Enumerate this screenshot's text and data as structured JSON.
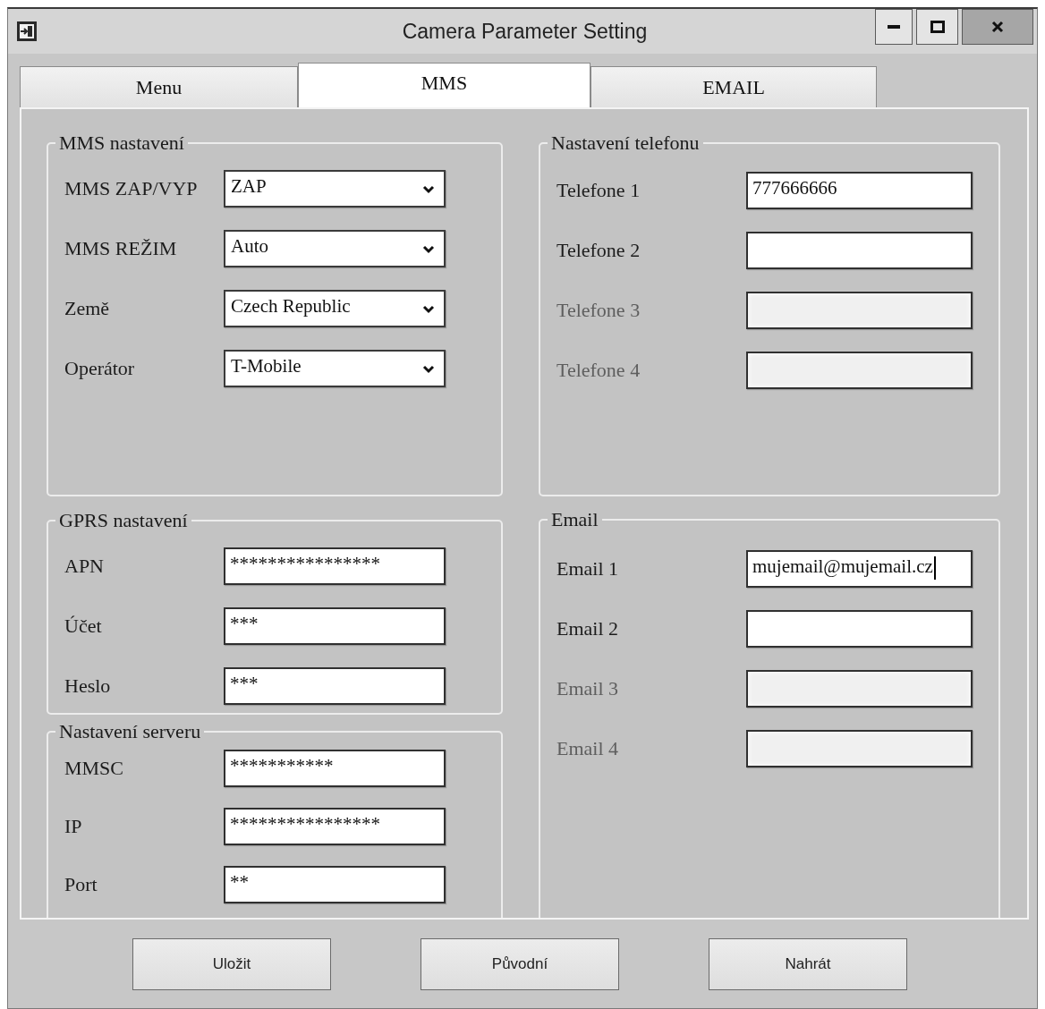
{
  "window": {
    "title": "Camera Parameter Setting"
  },
  "tabs": [
    {
      "label": "Menu",
      "selected": false
    },
    {
      "label": "MMS",
      "selected": true
    },
    {
      "label": "EMAIL",
      "selected": false
    }
  ],
  "mms_settings": {
    "title": "MMS nastavení",
    "rows": [
      {
        "label": "MMS ZAP/VYP",
        "value": "ZAP"
      },
      {
        "label": "MMS REŽIM",
        "value": "Auto"
      },
      {
        "label": "Země",
        "value": "Czech Republic"
      },
      {
        "label": "Operátor",
        "value": "T-Mobile"
      }
    ]
  },
  "gprs_settings": {
    "title": "GPRS nastavení",
    "rows": [
      {
        "label": "APN",
        "value": "****************"
      },
      {
        "label": "Účet",
        "value": "***"
      },
      {
        "label": "Heslo",
        "value": "***"
      }
    ]
  },
  "server_settings": {
    "title": "Nastavení serveru",
    "rows": [
      {
        "label": "MMSC",
        "value": "***********"
      },
      {
        "label": "IP",
        "value": "****************"
      },
      {
        "label": "Port",
        "value": "**"
      }
    ]
  },
  "phone_settings": {
    "title": "Nastavení telefonu",
    "rows": [
      {
        "label": "Telefone 1",
        "value": "777666666",
        "disabled": false
      },
      {
        "label": "Telefone 2",
        "disabled": false
      },
      {
        "label": "Telefone 3",
        "disabled": true
      },
      {
        "label": "Telefone 4",
        "disabled": true
      }
    ]
  },
  "email_settings": {
    "title": "Email",
    "rows": [
      {
        "label": "Email 1",
        "value": "mujemail@mujemail.cz",
        "disabled": false,
        "focused": true
      },
      {
        "label": "Email 2",
        "disabled": false,
        "focused": false
      },
      {
        "label": "Email 3",
        "disabled": true,
        "focused": false
      },
      {
        "label": "Email 4",
        "disabled": true,
        "focused": false
      }
    ]
  },
  "buttons": [
    "Uložit",
    "Původní",
    "Nahrát"
  ]
}
